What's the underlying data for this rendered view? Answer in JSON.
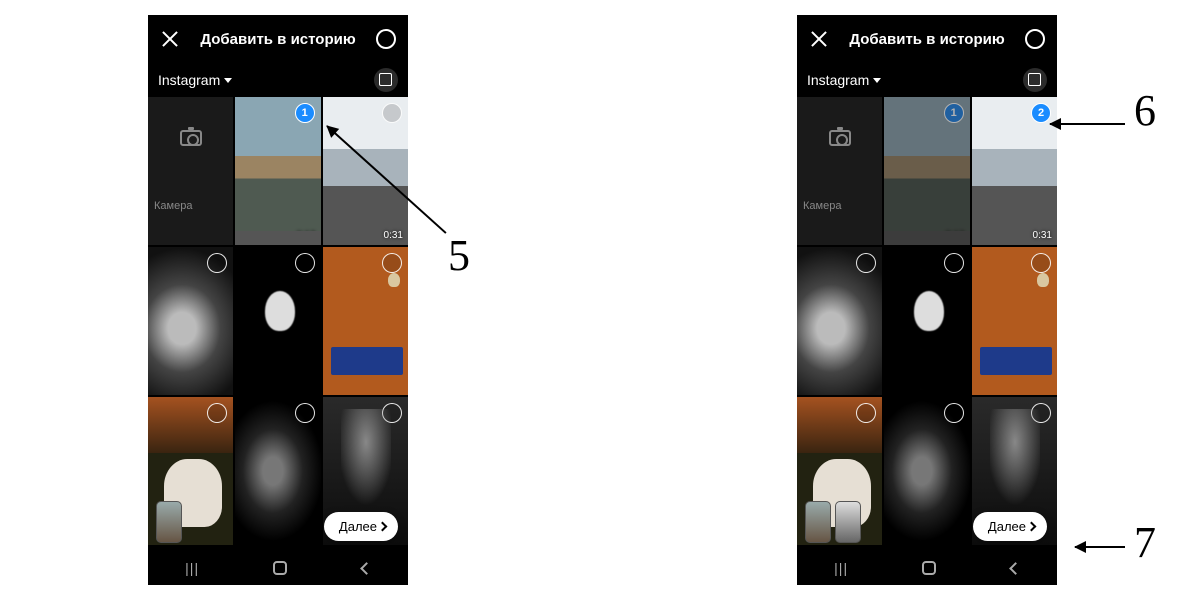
{
  "header": {
    "title": "Добавить в историю"
  },
  "subhead": {
    "source": "Instagram"
  },
  "camera": {
    "label": "Камера"
  },
  "next": {
    "label": "Далее"
  },
  "callouts": {
    "c5": "5",
    "c6": "6",
    "c7": "7"
  },
  "screens": {
    "a": {
      "tile1": {
        "duration": "0:13",
        "selected": true,
        "badge": "1"
      },
      "tile2": {
        "duration": "0:31",
        "selected": false
      }
    },
    "b": {
      "tile1": {
        "duration": "0:13",
        "selected": true,
        "badge": "1"
      },
      "tile2": {
        "duration": "0:31",
        "selected": true,
        "badge": "2"
      }
    }
  }
}
